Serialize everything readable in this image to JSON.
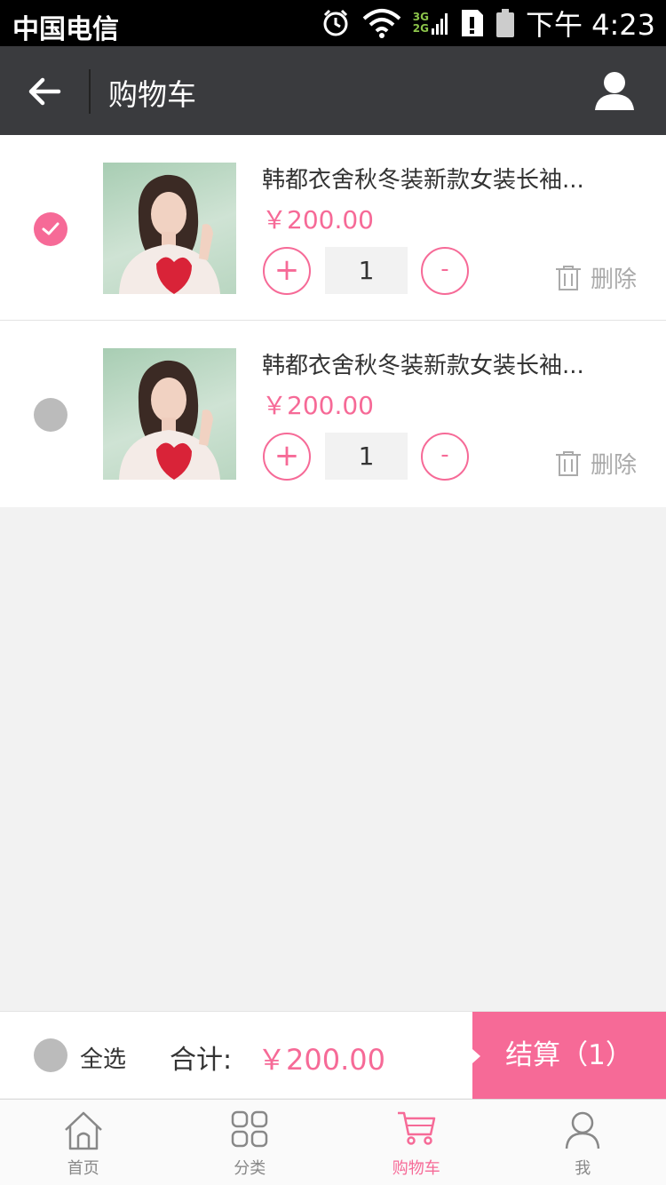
{
  "status_bar": {
    "carrier": "中国电信",
    "network_top": "3G",
    "network_bottom": "2G",
    "time": "下午 4:23"
  },
  "header": {
    "title": "购物车",
    "back_icon": "back-arrow-icon",
    "user_icon": "user-icon"
  },
  "cart": {
    "items": [
      {
        "name": "韩都衣舍秋冬装新款女装长袖...",
        "price": "￥200.00",
        "quantity": "1",
        "checked": true,
        "plus_label": "+",
        "minus_label": "-",
        "delete_label": "删除"
      },
      {
        "name": "韩都衣舍秋冬装新款女装长袖...",
        "price": "￥200.00",
        "quantity": "1",
        "checked": false,
        "plus_label": "+",
        "minus_label": "-",
        "delete_label": "删除"
      }
    ]
  },
  "checkout": {
    "select_all_label": "全选",
    "total_label": "合计:",
    "total_value": "￥200.00",
    "button_label": "结算（1）"
  },
  "tabbar": {
    "tabs": [
      {
        "label": "首页",
        "icon": "home-icon",
        "active": false
      },
      {
        "label": "分类",
        "icon": "category-grid-icon",
        "active": false
      },
      {
        "label": "购物车",
        "icon": "shopping-cart-icon",
        "active": true
      },
      {
        "label": "我",
        "icon": "person-icon",
        "active": false
      }
    ]
  },
  "colors": {
    "accent": "#f66a97",
    "header_bg": "#3a3b3e",
    "page_bg": "#f2f2f2",
    "unchecked": "#bbbbbb"
  }
}
